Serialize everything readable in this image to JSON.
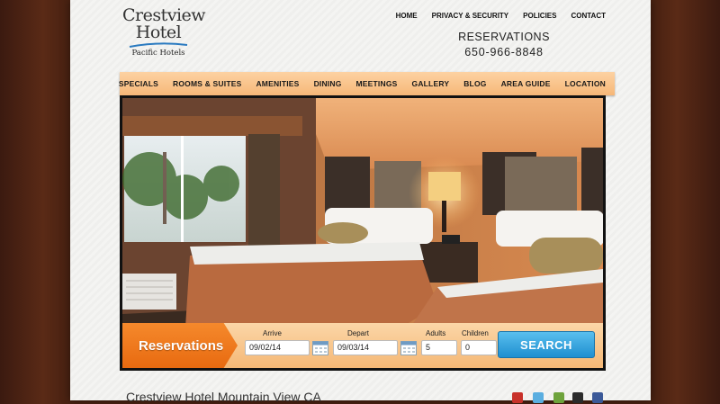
{
  "brand": {
    "line1": "Crestview",
    "line2": "Hotel",
    "subline": "Pacific Hotels"
  },
  "top_links": [
    "HOME",
    "PRIVACY & SECURITY",
    "POLICIES",
    "CONTACT"
  ],
  "reservations_header": {
    "label": "RESERVATIONS",
    "phone": "650-966-8848"
  },
  "nav": [
    "SPECIALS",
    "ROOMS & SUITES",
    "AMENITIES",
    "DINING",
    "MEETINGS",
    "GALLERY",
    "BLOG",
    "AREA GUIDE",
    "LOCATION"
  ],
  "booking": {
    "title": "Reservations",
    "arrive_label": "Arrive",
    "arrive_value": "09/02/14",
    "depart_label": "Depart",
    "depart_value": "09/03/14",
    "adults_label": "Adults",
    "adults_value": "5",
    "children_label": "Children",
    "children_value": "0",
    "search_label": "SEARCH"
  },
  "page_heading": "Crestview Hotel Mountain View CA",
  "social_icons": [
    "yelp-icon",
    "twitter-icon",
    "tripadvisor-icon",
    "foursquare-icon",
    "facebook-icon"
  ],
  "colors": {
    "accent_orange": "#f07a1e",
    "nav_bg": "#f9c48b",
    "search_blue": "#2f9fdc"
  }
}
